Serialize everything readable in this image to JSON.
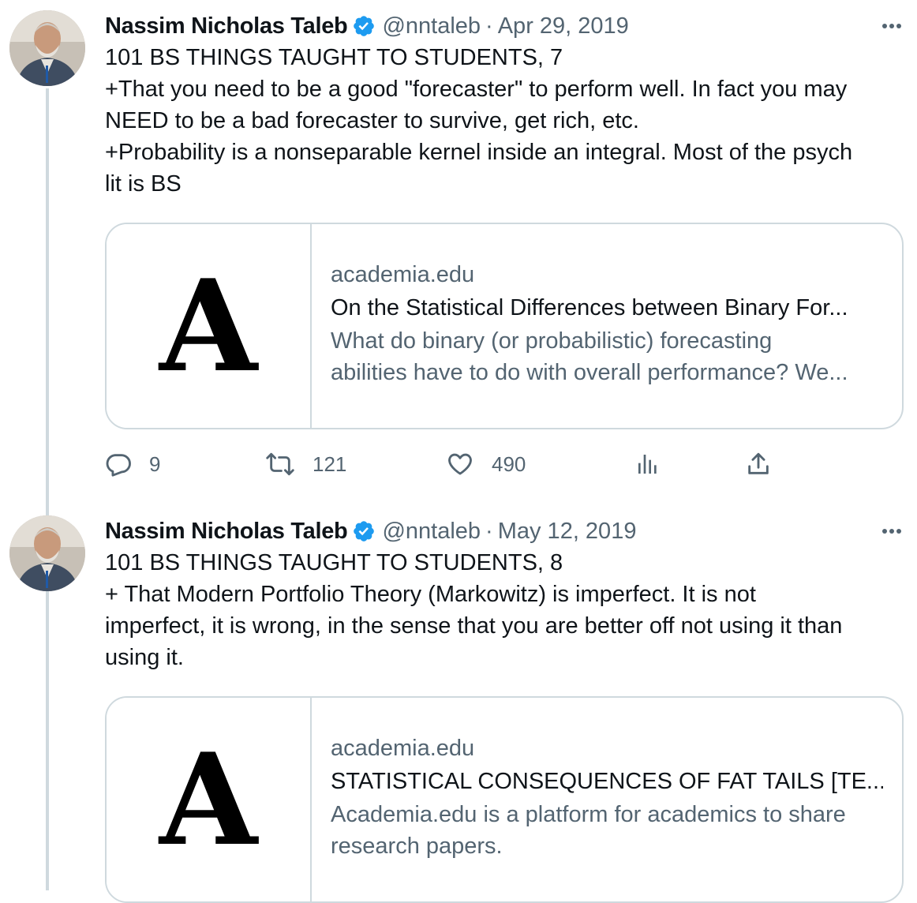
{
  "tweets": [
    {
      "author_name": "Nassim Nicholas Taleb",
      "handle": "@nntaleb",
      "separator": "·",
      "date": "Apr 29, 2019",
      "text_lines": [
        "101 BS THINGS TAUGHT TO STUDENTS, 7",
        "+That you need to be a good \"forecaster\" to perform well. In fact you may",
        "NEED to be a bad forecaster to survive, get rich, etc.",
        "+Probability is a nonseparable kernel inside an integral. Most of the psych",
        "lit is BS"
      ],
      "card": {
        "thumb_letter": "A",
        "domain": "academia.edu",
        "title": "On the Statistical Differences between Binary For...",
        "desc_lines": [
          "What do binary (or probabilistic) forecasting",
          "abilities have to do with overall performance? We..."
        ]
      },
      "actions": {
        "replies": "9",
        "retweets": "121",
        "likes": "490"
      },
      "icons": [
        "verified-badge-icon",
        "more-icon",
        "reply-icon",
        "retweet-icon",
        "like-icon",
        "views-icon",
        "share-icon"
      ]
    },
    {
      "author_name": "Nassim Nicholas Taleb",
      "handle": "@nntaleb",
      "separator": "·",
      "date": "May 12, 2019",
      "text_lines": [
        "101 BS THINGS TAUGHT TO STUDENTS, 8",
        "+ That Modern Portfolio Theory (Markowitz) is imperfect. It is not",
        "imperfect, it is wrong, in the sense that you are better off not using it than",
        "using it."
      ],
      "card": {
        "thumb_letter": "A",
        "domain": "academia.edu",
        "title": "STATISTICAL CONSEQUENCES OF FAT TAILS [TE...",
        "desc_lines": [
          "Academia.edu is a platform for academics to share",
          "research papers."
        ]
      }
    }
  ],
  "colors": {
    "text": "#0f1419",
    "secondary": "#536471",
    "border": "#cfd9de",
    "verified": "#1d9bf0"
  }
}
